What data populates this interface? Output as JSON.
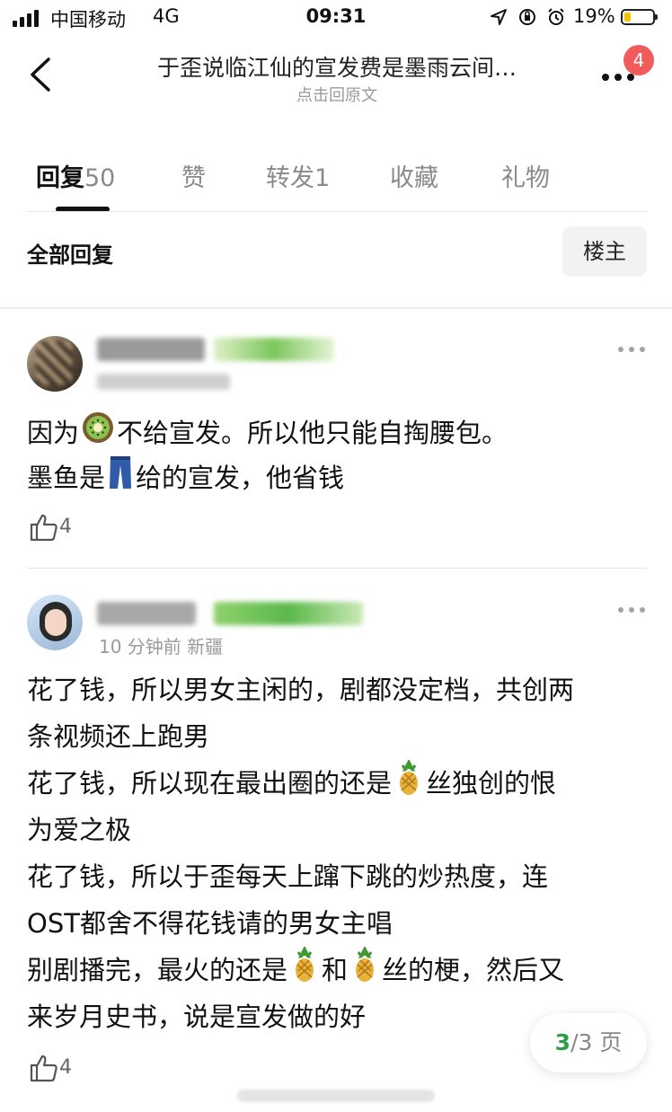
{
  "status_bar": {
    "carrier": "中国移动",
    "network": "4G",
    "time": "09:31",
    "battery_percent": "19%",
    "icons": [
      "signal-icon",
      "location-icon",
      "rotation-lock-icon",
      "alarm-icon",
      "battery-icon"
    ]
  },
  "nav": {
    "title": "于歪说临江仙的宣发费是墨雨云间…",
    "subtitle": "点击回原文",
    "badge": "4"
  },
  "tabs": [
    {
      "label": "回复",
      "count": "50",
      "active": true
    },
    {
      "label": "赞",
      "active": false
    },
    {
      "label": "转发",
      "count": "1",
      "active": false
    },
    {
      "label": "收藏",
      "active": false
    },
    {
      "label": "礼物",
      "active": false
    }
  ],
  "filter": {
    "all_replies": "全部回复",
    "owner_button": "楼主"
  },
  "comments": [
    {
      "lines": [
        {
          "before": "因为",
          "emoji": "kiwi-emoji",
          "after": "不给宣发。所以他只能自掏腰包。"
        },
        {
          "before": "墨鱼是",
          "emoji": "jeans-emoji",
          "after": "给的宣发，他省钱"
        }
      ],
      "likes": "4"
    },
    {
      "meta": "10 分钟前 新疆",
      "lines": [
        {
          "text": "花了钱，所以男女主闲的，剧都没定档，共创两"
        },
        {
          "text": "条视频还上跑男"
        },
        {
          "before": "花了钱，所以现在最出圈的还是",
          "emoji": "pineapple-emoji",
          "after": "丝独创的恨"
        },
        {
          "text": "为爱之极"
        },
        {
          "text": "花了钱，所以于歪每天上蹿下跳的炒热度，连"
        },
        {
          "text": "OST都舍不得花钱请的男女主唱"
        },
        {
          "before": "别剧播完，最火的还是",
          "emoji": "pineapple-emoji",
          "mid": "和",
          "emoji2": "pineapple-emoji",
          "after": "丝的梗，然后又"
        },
        {
          "text": "来岁月史书，说是宣发做的好"
        }
      ],
      "likes": "4"
    }
  ],
  "pager": {
    "current": "3",
    "total": "/3 页"
  },
  "colors": {
    "accent_green": "#2e9e44",
    "badge_red": "#f25b5b",
    "muted": "#9a9a9a"
  }
}
